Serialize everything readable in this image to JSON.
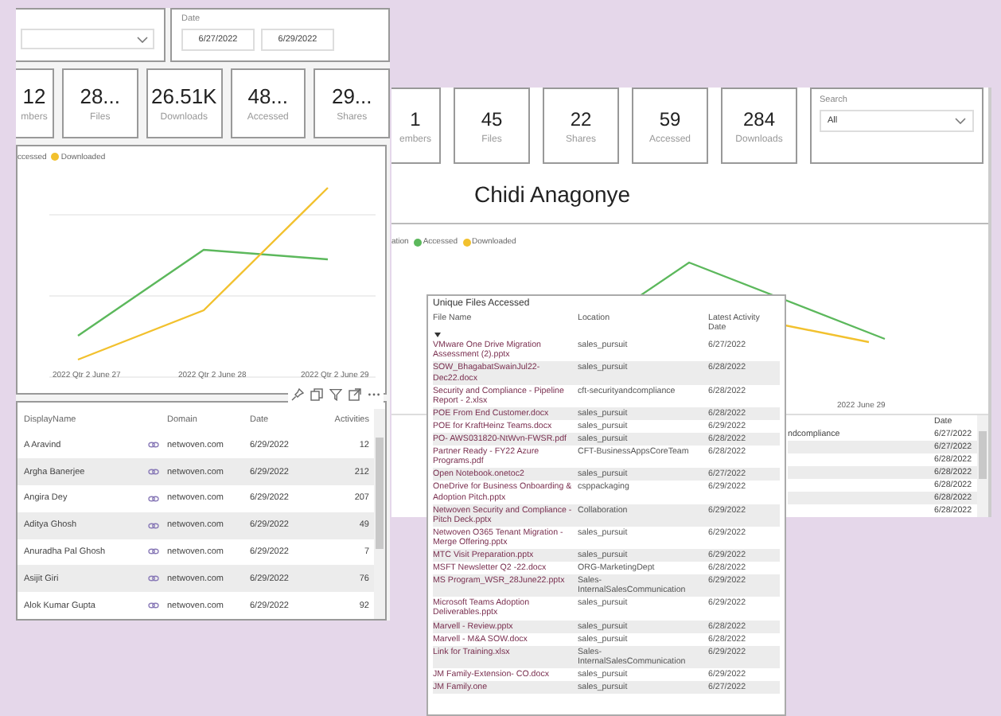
{
  "left_report": {
    "date_filter": {
      "label": "Date",
      "start": "6/27/2022",
      "end": "6/29/2022"
    },
    "cards": [
      {
        "value": "12",
        "label": "mbers"
      },
      {
        "value": "28...",
        "label": "Files"
      },
      {
        "value": "26.51K",
        "label": "Downloads"
      },
      {
        "value": "48...",
        "label": "Accessed"
      },
      {
        "value": "29...",
        "label": "Shares"
      }
    ],
    "chart": {
      "legend": [
        {
          "label": "ccessed"
        },
        {
          "label": "Downloaded",
          "color": "#f2c12e"
        }
      ],
      "x_labels": [
        "2022 Qtr 2 June 27",
        "2022 Qtr 2 June 28",
        "2022 Qtr 2 June 29"
      ]
    },
    "table": {
      "columns": [
        "DisplayName",
        "Domain",
        "Date",
        "Activities"
      ],
      "rows": [
        {
          "name": "A Aravind",
          "domain": "netwoven.com",
          "date": "6/29/2022",
          "activities": "12"
        },
        {
          "name": "Argha Banerjee",
          "domain": "netwoven.com",
          "date": "6/29/2022",
          "activities": "212"
        },
        {
          "name": "Angira Dey",
          "domain": "netwoven.com",
          "date": "6/29/2022",
          "activities": "207"
        },
        {
          "name": "Aditya Ghosh",
          "domain": "netwoven.com",
          "date": "6/29/2022",
          "activities": "49"
        },
        {
          "name": "Anuradha Pal Ghosh",
          "domain": "netwoven.com",
          "date": "6/29/2022",
          "activities": "7"
        },
        {
          "name": "Asijit Giri",
          "domain": "netwoven.com",
          "date": "6/29/2022",
          "activities": "76"
        },
        {
          "name": "Alok Kumar Gupta",
          "domain": "netwoven.com",
          "date": "6/29/2022",
          "activities": "92"
        }
      ]
    }
  },
  "right_report": {
    "cards": [
      {
        "value": "1",
        "label": "embers"
      },
      {
        "value": "45",
        "label": "Files"
      },
      {
        "value": "22",
        "label": "Shares"
      },
      {
        "value": "59",
        "label": "Accessed"
      },
      {
        "value": "284",
        "label": "Downloads"
      }
    ],
    "search": {
      "label": "Search",
      "value": "All"
    },
    "title": "Chidi Anagonye",
    "chart": {
      "legend": [
        {
          "label": "ation"
        },
        {
          "label": "Accessed",
          "color": "#5cb85c"
        },
        {
          "label": "Downloaded",
          "color": "#f2c12e"
        }
      ],
      "x_label": "2022 June 29"
    },
    "table": {
      "column": "Date",
      "rows": [
        {
          "location": "ndcompliance",
          "date": "6/27/2022"
        },
        {
          "date": "6/27/2022"
        },
        {
          "date": "6/28/2022"
        },
        {
          "date": "6/28/2022"
        },
        {
          "date": "6/28/2022"
        },
        {
          "date": "6/28/2022"
        },
        {
          "date": "6/28/2022"
        }
      ]
    }
  },
  "files_popup": {
    "title": "Unique Files Accessed",
    "columns": [
      "File Name",
      "Location",
      "Latest Activity Date"
    ],
    "rows": [
      {
        "file": "VMware One Drive Migration Assessment (2).pptx",
        "location": "sales_pursuit",
        "date": "6/27/2022"
      },
      {
        "file": "SOW_BhagabatSwainJul22-Dec22.docx",
        "location": "sales_pursuit",
        "date": "6/28/2022"
      },
      {
        "file": "Security and Compliance - Pipeline Report - 2.xlsx",
        "location": "cft-securityandcompliance",
        "date": "6/28/2022"
      },
      {
        "file": "POE From End Customer.docx",
        "location": "sales_pursuit",
        "date": "6/28/2022"
      },
      {
        "file": "POE for KraftHeinz Teams.docx",
        "location": "sales_pursuit",
        "date": "6/29/2022"
      },
      {
        "file": "PO- AWS031820-NtWvn-FWSR.pdf",
        "location": "sales_pursuit",
        "date": "6/28/2022"
      },
      {
        "file": "Partner Ready - FY22 Azure Programs.pdf",
        "location": "CFT-BusinessAppsCoreTeam",
        "date": "6/28/2022"
      },
      {
        "file": "Open Notebook.onetoc2",
        "location": "sales_pursuit",
        "date": "6/27/2022"
      },
      {
        "file": "OneDrive for Business Onboarding & Adoption Pitch.pptx",
        "location": "csppackaging",
        "date": "6/29/2022"
      },
      {
        "file": "Netwoven Security and Compliance - Pitch Deck.pptx",
        "location": "Collaboration",
        "date": "6/29/2022"
      },
      {
        "file": "Netwoven O365 Tenant Migration - Merge Offering.pptx",
        "location": "sales_pursuit",
        "date": "6/29/2022"
      },
      {
        "file": "MTC Visit Preparation.pptx",
        "location": "sales_pursuit",
        "date": "6/29/2022"
      },
      {
        "file": "MSFT Newsletter Q2 -22.docx",
        "location": "ORG-MarketingDept",
        "date": "6/28/2022"
      },
      {
        "file": "MS Program_WSR_28June22.pptx",
        "location": "Sales-InternalSalesCommunication",
        "date": "6/29/2022"
      },
      {
        "file": "Microsoft Teams Adoption Deliverables.pptx",
        "location": "sales_pursuit",
        "date": "6/29/2022"
      },
      {
        "file": "Marvell - Review.pptx",
        "location": "sales_pursuit",
        "date": "6/28/2022"
      },
      {
        "file": "Marvell - M&A SOW.docx",
        "location": "sales_pursuit",
        "date": "6/28/2022"
      },
      {
        "file": "Link for Training.xlsx",
        "location": "Sales-InternalSalesCommunication",
        "date": "6/29/2022"
      },
      {
        "file": "JM Family-Extension- CO.docx",
        "location": "sales_pursuit",
        "date": "6/29/2022"
      },
      {
        "file": "JM Family.one",
        "location": "sales_pursuit",
        "date": "6/27/2022"
      }
    ]
  }
}
